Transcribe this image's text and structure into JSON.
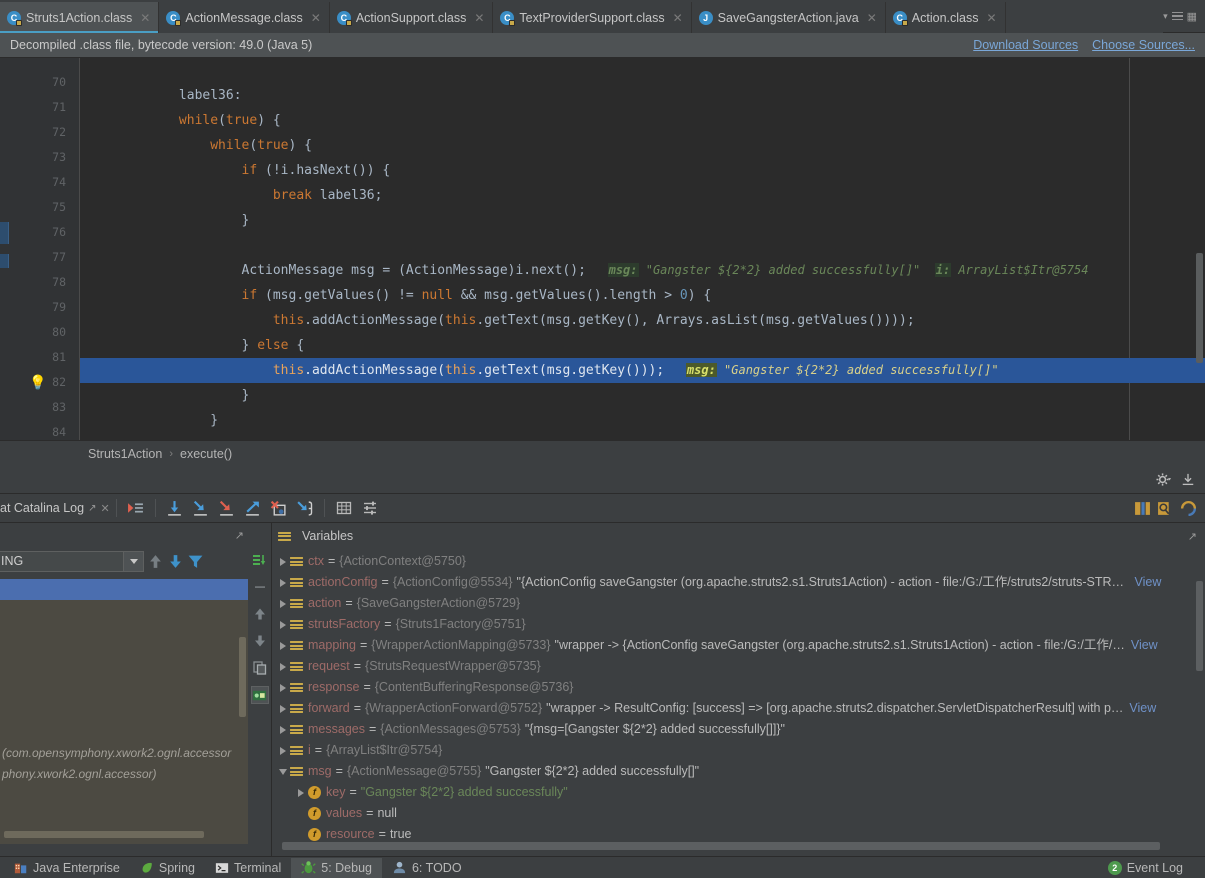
{
  "tabs": [
    {
      "label": "Struts1Action.class",
      "icon": "java-class-icon",
      "active": true,
      "locked": true
    },
    {
      "label": "ActionMessage.class",
      "icon": "java-class-icon",
      "active": false,
      "locked": true
    },
    {
      "label": "ActionSupport.class",
      "icon": "java-class-icon",
      "active": false,
      "locked": true
    },
    {
      "label": "TextProviderSupport.class",
      "icon": "java-class-icon",
      "active": false,
      "locked": true
    },
    {
      "label": "SaveGangsterAction.java",
      "icon": "java-file-icon",
      "active": false,
      "locked": false
    },
    {
      "label": "Action.class",
      "icon": "java-class-icon",
      "active": false,
      "locked": true
    }
  ],
  "notice": {
    "text": "Decompiled .class file, bytecode version: 49.0 (Java 5)",
    "download_sources": "Download Sources",
    "choose_sources": "Choose Sources..."
  },
  "editor": {
    "lines": [
      {
        "num": "70",
        "code": "",
        "highlight": false
      },
      {
        "num": "71",
        "code": "            label36:",
        "highlight": false
      },
      {
        "num": "72",
        "code": "            while(true) {",
        "highlight": false
      },
      {
        "num": "73",
        "code": "                while(true) {",
        "highlight": false
      },
      {
        "num": "74",
        "code": "                    if (!i.hasNext()) {",
        "highlight": false
      },
      {
        "num": "75",
        "code": "                        break label36;",
        "highlight": false
      },
      {
        "num": "76",
        "code": "                    }",
        "highlight": false
      },
      {
        "num": "77",
        "code": "",
        "highlight": false
      },
      {
        "num": "78",
        "code": "                    ActionMessage msg = (ActionMessage)i.next();",
        "highlight": false
      },
      {
        "num": "79",
        "code": "                    if (msg.getValues() != null && msg.getValues().length > 0) {",
        "highlight": false
      },
      {
        "num": "80",
        "code": "                        this.addActionMessage(this.getText(msg.getKey(), Arrays.asList(msg.getValues())));",
        "highlight": false
      },
      {
        "num": "81",
        "code": "                    } else {",
        "highlight": false
      },
      {
        "num": "82",
        "code": "                        this.addActionMessage(this.getText(msg.getKey()));",
        "highlight": true
      },
      {
        "num": "83",
        "code": "                    }",
        "highlight": false
      },
      {
        "num": "84",
        "code": "                }",
        "highlight": false
      }
    ],
    "inline_hints": [
      {
        "line": "78",
        "name": "msg:",
        "value": "\"Gangster ${2*2} added successfully[]\""
      },
      {
        "line": "78",
        "name": "i:",
        "value": "ArrayList$Itr@5754"
      },
      {
        "line": "82",
        "name": "msg:",
        "value": "\"Gangster ${2*2} added successfully[]\""
      }
    ],
    "gutter_bulb_icon": "light-bulb-icon"
  },
  "breadcrumb": {
    "class": "Struts1Action",
    "separator": "›",
    "method": "execute()"
  },
  "debug": {
    "session_tab": "at Catalina Log",
    "toolbar_icons": [
      "show-execution-point-icon",
      "step-over-icon",
      "step-into-icon",
      "force-step-into-icon",
      "step-out-icon",
      "drop-frame-icon",
      "run-to-cursor-icon",
      "evaluate-expression-icon",
      "settings-icon"
    ],
    "toolbar_right_icons": [
      "layout-icon",
      "mute-breakpoints-icon",
      "restore-layout-icon"
    ],
    "top_strip_icons": [
      "gear-icon",
      "minimize-icon"
    ],
    "frames": {
      "thread_state": "ING",
      "filter_icons": [
        "sort-up-icon",
        "sort-down-icon",
        "filter-icon"
      ],
      "rows": [
        {
          "label": "",
          "selected": true
        },
        {
          "label": "",
          "selected": false
        },
        {
          "label": "",
          "selected": false
        },
        {
          "label": "",
          "selected": false
        },
        {
          "label": "",
          "selected": false
        },
        {
          "label": "",
          "selected": false
        },
        {
          "label": "(com.opensymphony.xwork2.ognl.accessor",
          "selected": false
        },
        {
          "label": "phony.xwork2.ognl.accessor)",
          "selected": false
        }
      ]
    },
    "variables": {
      "title": "Variables",
      "rail_icons": [
        "add-watch-icon",
        "remove-icon",
        "move-up-icon",
        "move-down-icon",
        "copy-icon",
        "inspect-icon"
      ],
      "rows": [
        {
          "indent": 0,
          "toggle": "right",
          "icon": "variable-icon",
          "name": "ctx",
          "value_ref": "{ActionContext@5750}",
          "value_str": "",
          "view": false
        },
        {
          "indent": 0,
          "toggle": "right",
          "icon": "variable-icon",
          "name": "actionConfig",
          "value_ref": "{ActionConfig@5534}",
          "value_str": "\"{ActionConfig saveGangster (org.apache.struts2.s1.Struts1Action) - action - file:/G:/工作/struts2/struts-STRU…",
          "view": true
        },
        {
          "indent": 0,
          "toggle": "right",
          "icon": "variable-icon",
          "name": "action",
          "value_ref": "{SaveGangsterAction@5729}",
          "value_str": "",
          "view": false
        },
        {
          "indent": 0,
          "toggle": "right",
          "icon": "variable-icon",
          "name": "strutsFactory",
          "value_ref": "{Struts1Factory@5751}",
          "value_str": "",
          "view": false
        },
        {
          "indent": 0,
          "toggle": "right",
          "icon": "variable-icon",
          "name": "mapping",
          "value_ref": "{WrapperActionMapping@5733}",
          "value_str": "\"wrapper -> {ActionConfig saveGangster (org.apache.struts2.s1.Struts1Action) - action - file:/G:/工作/…",
          "view": true
        },
        {
          "indent": 0,
          "toggle": "right",
          "icon": "variable-icon",
          "name": "request",
          "value_ref": "{StrutsRequestWrapper@5735}",
          "value_str": "",
          "view": false
        },
        {
          "indent": 0,
          "toggle": "right",
          "icon": "variable-icon",
          "name": "response",
          "value_ref": "{ContentBufferingResponse@5736}",
          "value_str": "",
          "view": false
        },
        {
          "indent": 0,
          "toggle": "right",
          "icon": "variable-icon",
          "name": "forward",
          "value_ref": "{WrapperActionForward@5752}",
          "value_str": "\"wrapper -> ResultConfig: [success] => [org.apache.struts2.dispatcher.ServletDispatcherResult] with p…",
          "view": true
        },
        {
          "indent": 0,
          "toggle": "right",
          "icon": "variable-icon",
          "name": "messages",
          "value_ref": "{ActionMessages@5753}",
          "value_str": "\"{msg=[Gangster ${2*2} added successfully[]]}\"",
          "view": false
        },
        {
          "indent": 0,
          "toggle": "right",
          "icon": "variable-icon",
          "name": "i",
          "value_ref": "{ArrayList$Itr@5754}",
          "value_str": "",
          "view": false
        },
        {
          "indent": 0,
          "toggle": "down",
          "icon": "variable-icon",
          "name": "msg",
          "value_ref": "{ActionMessage@5755}",
          "value_str": "\"Gangster ${2*2} added successfully[]\"",
          "view": false
        },
        {
          "indent": 1,
          "toggle": "right",
          "icon": "field-icon",
          "name": "key",
          "value_ref": "",
          "value_str": "\"Gangster ${2*2} added successfully\"",
          "str_green": true,
          "view": false
        },
        {
          "indent": 1,
          "toggle": "none",
          "icon": "field-icon",
          "name": "values",
          "value_ref": "",
          "value_str": "null",
          "view": false
        },
        {
          "indent": 1,
          "toggle": "none",
          "icon": "field-icon",
          "name": "resource",
          "value_ref": "",
          "value_str": "true",
          "view": false
        }
      ],
      "view_label": "View"
    }
  },
  "statusbar": {
    "items": [
      {
        "label": "Java Enterprise",
        "icon": "java-enterprise-icon",
        "active": false,
        "mnemonic": ""
      },
      {
        "label": "Spring",
        "icon": "spring-leaf-icon",
        "active": false,
        "mnemonic": ""
      },
      {
        "label": "Terminal",
        "icon": "terminal-icon",
        "active": false,
        "mnemonic": ""
      },
      {
        "label": "5: Debug",
        "icon": "debug-bug-icon",
        "active": true,
        "mnemonic": "5"
      },
      {
        "label": "6: TODO",
        "icon": "todo-icon",
        "active": false,
        "mnemonic": "6"
      }
    ],
    "event_log": {
      "label": "Event Log",
      "count": "2",
      "icon": "event-log-icon"
    }
  },
  "colors": {
    "accent_blue": "#4a9ec4",
    "selection_blue": "#2a5699",
    "frame_selection": "#4b6eaf",
    "editor_bg": "#2b2b2b",
    "panel_bg": "#3c3f41",
    "keyword_orange": "#cc7832",
    "string_green": "#6a8759",
    "number_blue": "#6897bb",
    "text_default": "#a9b7c6",
    "link_blue": "#7aa7d8",
    "var_name_red": "#9e6b68"
  }
}
